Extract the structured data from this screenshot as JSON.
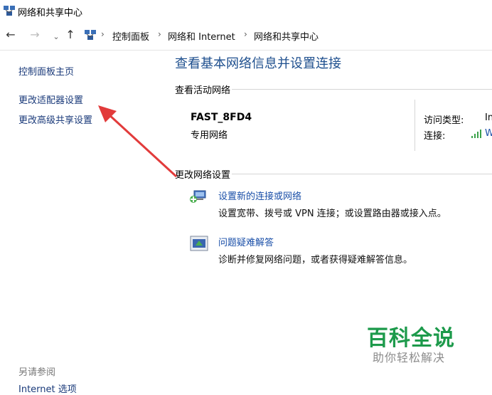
{
  "window": {
    "title": "网络和共享中心"
  },
  "address_bar": {
    "crumbs": [
      "控制面板",
      "网络和 Internet",
      "网络和共享中心"
    ]
  },
  "sidebar": {
    "items": [
      {
        "label": "控制面板主页"
      },
      {
        "label": "更改适配器设置"
      },
      {
        "label": "更改高级共享设置"
      }
    ],
    "see_also": "另请参阅",
    "see_also_items": [
      {
        "label": "Internet 选项"
      }
    ]
  },
  "main": {
    "title": "查看基本网络信息并设置连接",
    "active_networks_label": "查看活动网络",
    "network": {
      "name": "FAST_8FD4",
      "type": "专用网络",
      "access_type_label": "访问类型:",
      "access_type_value": "In",
      "connection_label": "连接:",
      "connection_value": "W"
    },
    "change_settings_label": "更改网络设置",
    "tasks": [
      {
        "link": "设置新的连接或网络",
        "desc": "设置宽带、拨号或 VPN 连接；或设置路由器或接入点。",
        "icon": "new-connection-icon"
      },
      {
        "link": "问题疑难解答",
        "desc": "诊断并修复网络问题，或者获得疑难解答信息。",
        "icon": "troubleshoot-icon"
      }
    ]
  },
  "watermark": {
    "title": "百科全说",
    "subtitle": "助你轻松解决"
  },
  "colors": {
    "link": "#1a4fa8",
    "title": "#1e4f8e",
    "arrow": "#e23b3b",
    "watermark": "#1d9a4b"
  }
}
